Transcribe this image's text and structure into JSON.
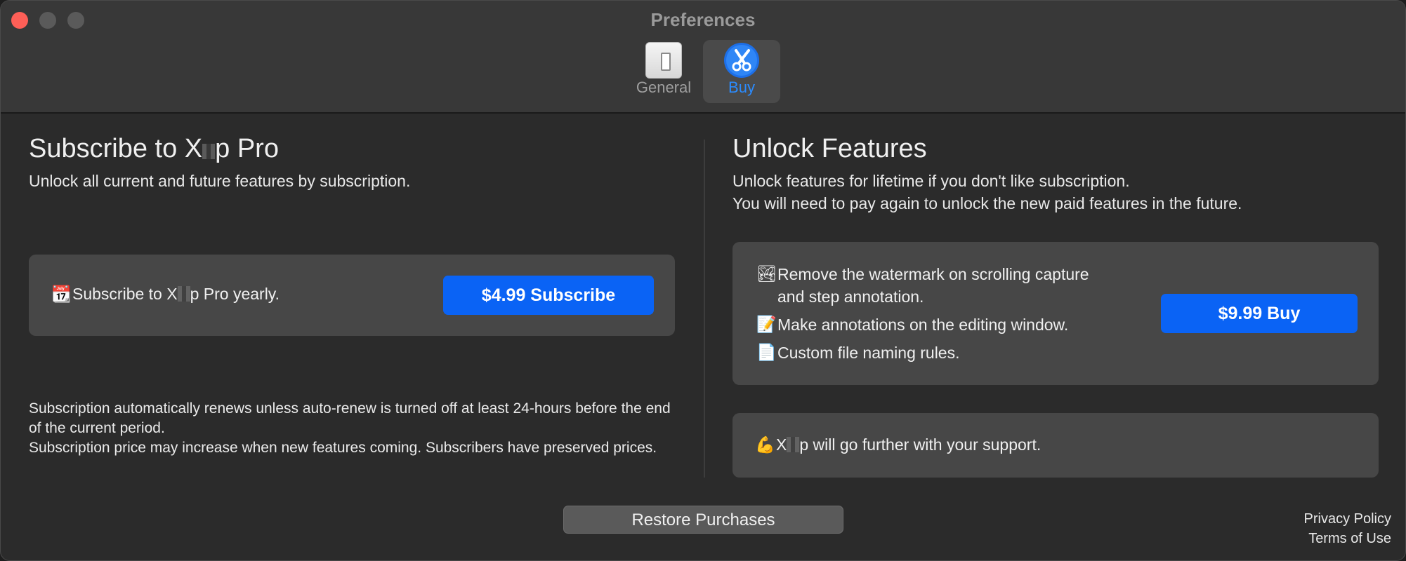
{
  "window": {
    "title": "Preferences",
    "tabs": [
      {
        "label": "General",
        "icon": "switch-icon"
      },
      {
        "label": "Buy",
        "icon": "scissors-icon",
        "selected": true
      }
    ]
  },
  "subscribe": {
    "heading_prefix": "Subscribe to X",
    "heading_suffix": "p Pro",
    "subtitle": "Unlock all current and future features by subscription.",
    "card_prefix": "Subscribe to X",
    "card_suffix": "p Pro yearly.",
    "card_icon": "calendar-icon",
    "button_label": "$4.99 Subscribe"
  },
  "legal": {
    "line1": "Subscription automatically renews unless auto-renew is turned off at least 24-hours before the end of the current period.",
    "line2": "Subscription price may increase when new features coming. Subscribers have preserved prices."
  },
  "unlock": {
    "heading": "Unlock Features",
    "subtitle_line1": "Unlock features for lifetime if you don't like subscription.",
    "subtitle_line2": "You will need to pay again to unlock the new paid features in the future.",
    "features": [
      {
        "icon": "picture-icon",
        "line1": "Remove the watermark on scrolling capture",
        "line2": "and step annotation."
      },
      {
        "icon": "memo-icon",
        "line1": "Make annotations on the editing window."
      },
      {
        "icon": "document-icon",
        "line1": "Custom file naming rules."
      }
    ],
    "button_label": "$9.99 Buy",
    "support_prefix": "X",
    "support_suffix": "p will go further with your support.",
    "support_icon": "flexed-biceps-icon"
  },
  "footer": {
    "restore_label": "Restore Purchases",
    "privacy_label": "Privacy Policy",
    "terms_label": "Terms of Use"
  },
  "colors": {
    "accent": "#0a63f5",
    "tab_selected_text": "#2b8cff",
    "close_button": "#fe5f57"
  }
}
